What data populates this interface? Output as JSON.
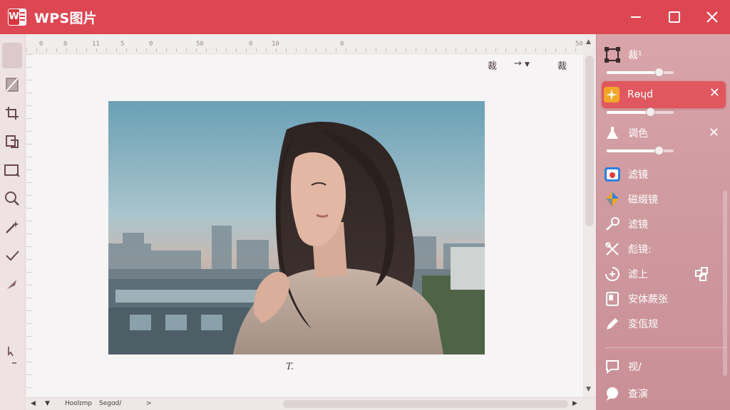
{
  "app": {
    "title": "WPS图片",
    "logo_letter": "W"
  },
  "canvas": {
    "ruler_labels": [
      "0",
      "0",
      "11",
      "5",
      "0",
      "50",
      "0",
      "10",
      "0",
      "50"
    ],
    "tool_left": "裁",
    "tool_middle": "→",
    "tool_right": "裁",
    "caption": "T."
  },
  "panel": {
    "crop_label": "裁¹",
    "crop_slider": 0.78,
    "selected_label": "Rөɥd",
    "selected_slider": 0.65,
    "adjust_label": "调色",
    "adjust_slider": 0.78,
    "items": [
      {
        "label": "滤镜"
      },
      {
        "label": "磁缀镜"
      },
      {
        "label": "滤镜"
      },
      {
        "label": "彪镜:"
      },
      {
        "label": "滤上"
      },
      {
        "label": "安体蕨张"
      },
      {
        "label": "変佤规"
      }
    ],
    "bottom_items": [
      {
        "label": "视/"
      },
      {
        "label": "查演"
      }
    ]
  },
  "status": {
    "segment1": "Hoolɪmp",
    "segment2": "Segɑd/",
    "nav_arrow": ">"
  },
  "colors": {
    "titlebar": "#dd4752",
    "accent": "#e0575f",
    "panel": "#d9a5aa"
  }
}
